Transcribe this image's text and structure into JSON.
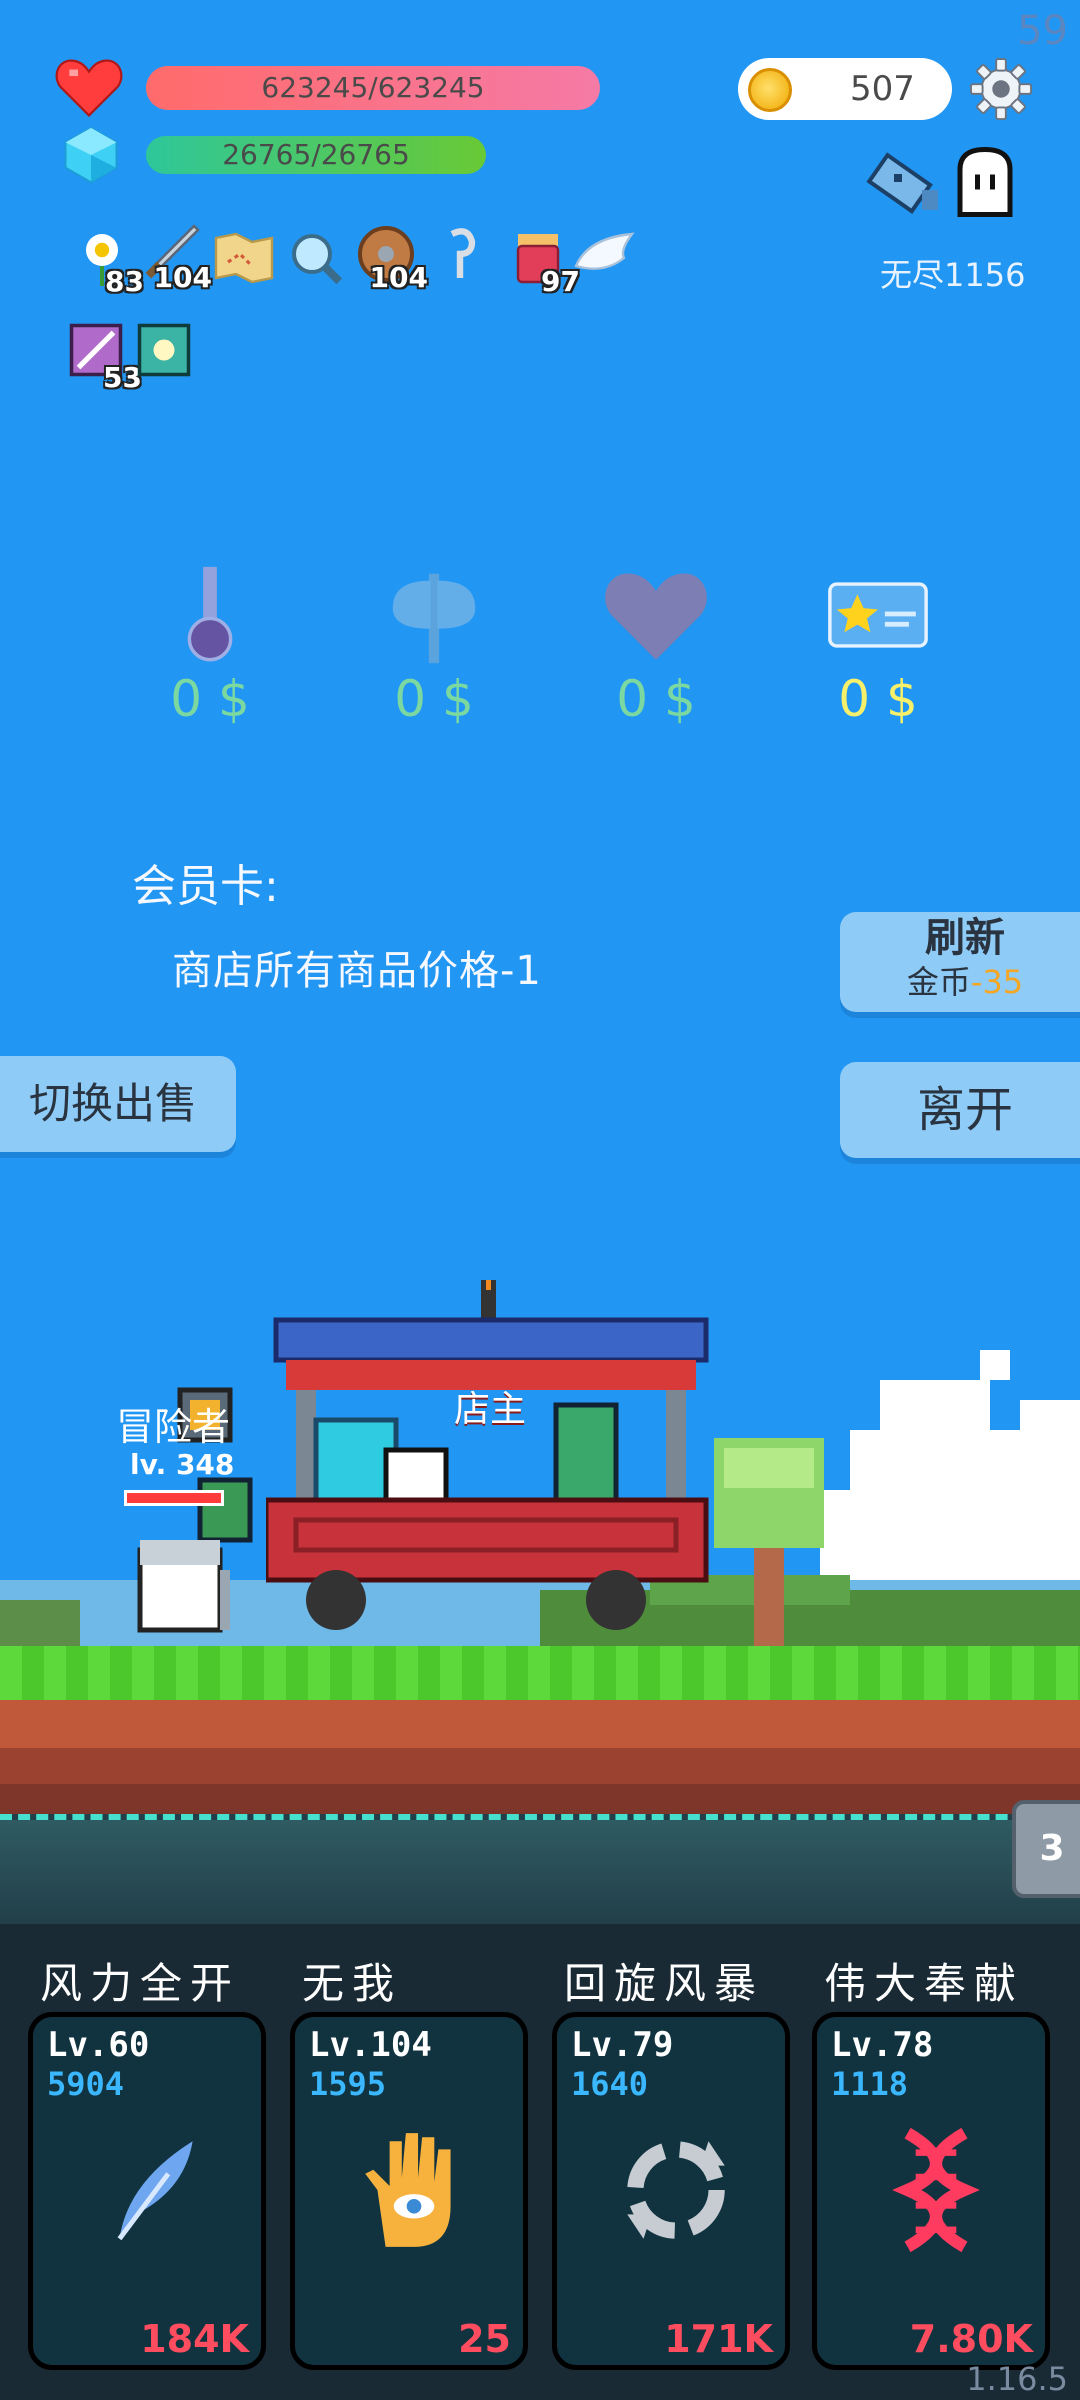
{
  "fps": "59",
  "version": "1.16.5",
  "player": {
    "hp_text": "623245/623245",
    "mp_text": "26765/26765",
    "name": "冒险者",
    "level": "lv. 348"
  },
  "coins": "507",
  "endless_label": "无尽1156",
  "items": [
    {
      "icon": "flower-icon",
      "count": "83"
    },
    {
      "icon": "sword-icon",
      "count": "104"
    },
    {
      "icon": "map-icon",
      "count": ""
    },
    {
      "icon": "magnifier-icon",
      "count": ""
    },
    {
      "icon": "shield-icon",
      "count": "104"
    },
    {
      "icon": "hook-icon",
      "count": ""
    },
    {
      "icon": "jar-icon",
      "count": "97"
    },
    {
      "icon": "wing-icon",
      "count": ""
    },
    {
      "icon": "scroll-icon",
      "count": "53"
    },
    {
      "icon": "lamp-card-icon",
      "count": ""
    }
  ],
  "shop_slots": [
    {
      "icon": "potion-icon",
      "price": "0 $"
    },
    {
      "icon": "axe-icon",
      "price": "0 $"
    },
    {
      "icon": "heart-icon",
      "price": "0 $"
    },
    {
      "icon": "star-card-icon",
      "price": "0 $"
    }
  ],
  "member": {
    "title": "会员卡:",
    "desc": "商店所有商品价格-1"
  },
  "buttons": {
    "refresh": "刷新",
    "refresh_cost_label": "金币",
    "refresh_cost": "-35",
    "leave": "离开",
    "switch_sell": "切换出售"
  },
  "shopkeeper_label": "店主",
  "wave_badge": "3",
  "skills": [
    {
      "name": "风力全开",
      "level": "Lv.60",
      "value": "5904",
      "cost": "184K",
      "icon": "feather-icon"
    },
    {
      "name": "无我",
      "level": "Lv.104",
      "value": "1595",
      "cost": "25",
      "icon": "eye-hand-icon"
    },
    {
      "name": "回旋风暴",
      "level": "Lv.79",
      "value": "1640",
      "cost": "171K",
      "icon": "cycle-icon"
    },
    {
      "name": "伟大奉献",
      "level": "Lv.78",
      "value": "1118",
      "cost": "7.80K",
      "icon": "dna-icon"
    }
  ],
  "colors": {
    "sky": "#2196f3",
    "hp": "#ff6b6b",
    "mp": "#2ec79a",
    "cost_red": "#ff4d5f",
    "value_blue": "#3ab7ff"
  }
}
